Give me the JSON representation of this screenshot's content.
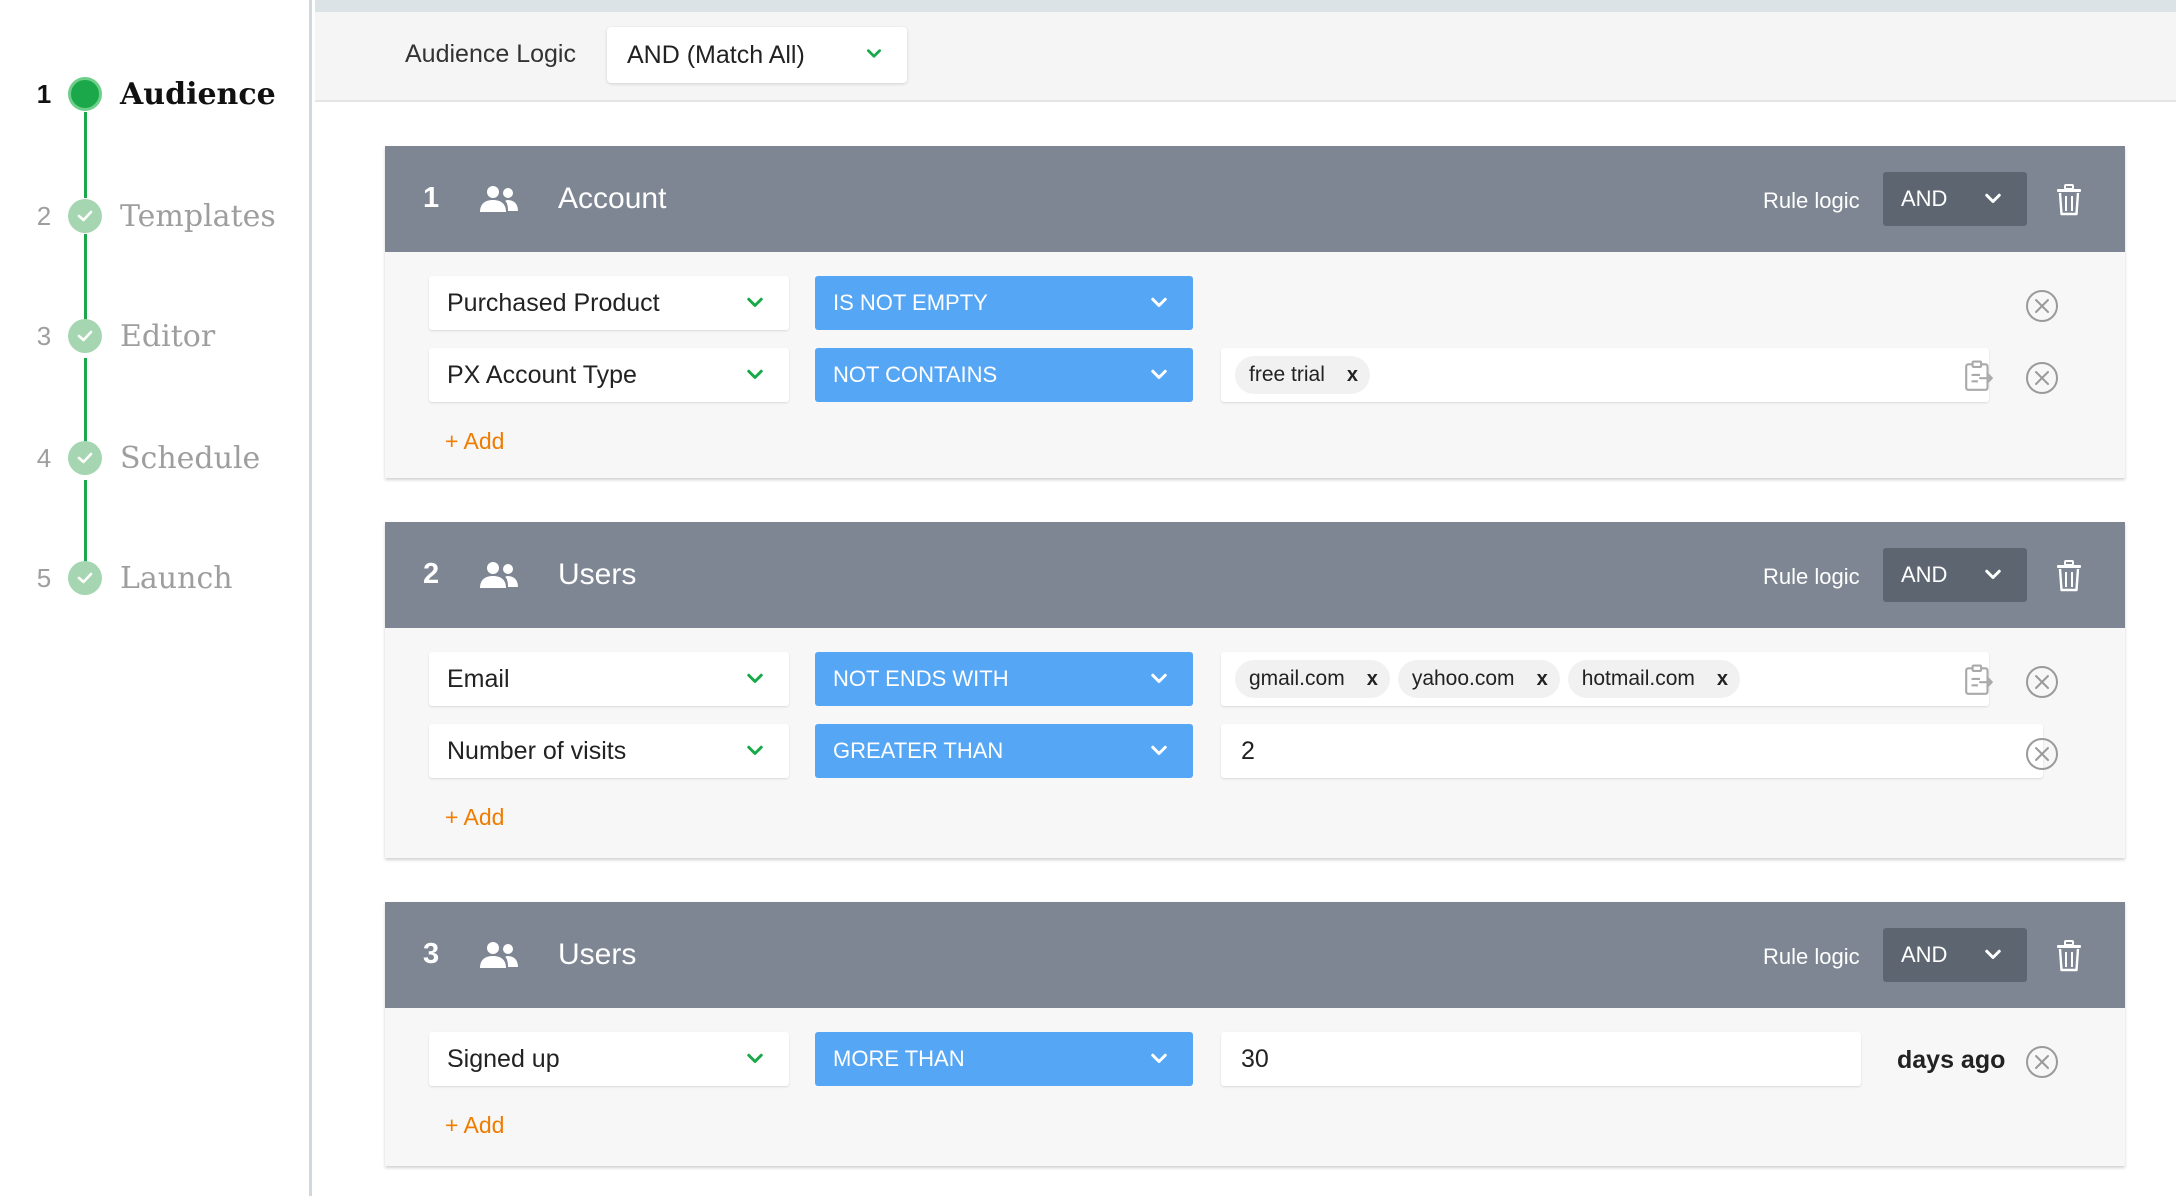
{
  "steps": [
    {
      "num": "1",
      "label": "Audience"
    },
    {
      "num": "2",
      "label": "Templates"
    },
    {
      "num": "3",
      "label": "Editor"
    },
    {
      "num": "4",
      "label": "Schedule"
    },
    {
      "num": "5",
      "label": "Launch"
    }
  ],
  "active_step": 1,
  "audience_logic": {
    "label": "Audience Logic",
    "value": "AND (Match All)"
  },
  "rule_groups": [
    {
      "num": "1",
      "title": "Account",
      "rule_logic_label": "Rule logic",
      "rule_logic": "AND",
      "rules": [
        {
          "field": "Purchased Product",
          "operator": "IS NOT EMPTY"
        },
        {
          "field": "PX Account Type",
          "operator": "NOT CONTAINS",
          "tags": [
            "free trial"
          ]
        }
      ],
      "add_label": "+ Add"
    },
    {
      "num": "2",
      "title": "Users",
      "rule_logic_label": "Rule logic",
      "rule_logic": "AND",
      "rules": [
        {
          "field": "Email",
          "operator": "NOT ENDS WITH",
          "tags": [
            "gmail.com",
            "yahoo.com",
            "hotmail.com"
          ]
        },
        {
          "field": "Number of visits",
          "operator": "GREATER THAN",
          "value": "2"
        }
      ],
      "add_label": "+ Add"
    },
    {
      "num": "3",
      "title": "Users",
      "rule_logic_label": "Rule logic",
      "rule_logic": "AND",
      "rules": [
        {
          "field": "Signed up",
          "operator": "MORE THAN",
          "value": "30",
          "suffix": "days ago"
        }
      ],
      "add_label": "+ Add"
    }
  ],
  "tag_remove_glyph": "x",
  "icons": {
    "step_check": "check-icon",
    "group": "users-group-icon",
    "dropdown": "chevron-down-icon",
    "delete_group": "trash-icon",
    "paste": "paste-list-icon",
    "remove_rule": "close-circle-icon"
  },
  "colors": {
    "accent_green": "#1aa84a",
    "operator_blue": "#55a6f5",
    "card_header": "#7d8692",
    "add_orange": "#f07c00"
  }
}
